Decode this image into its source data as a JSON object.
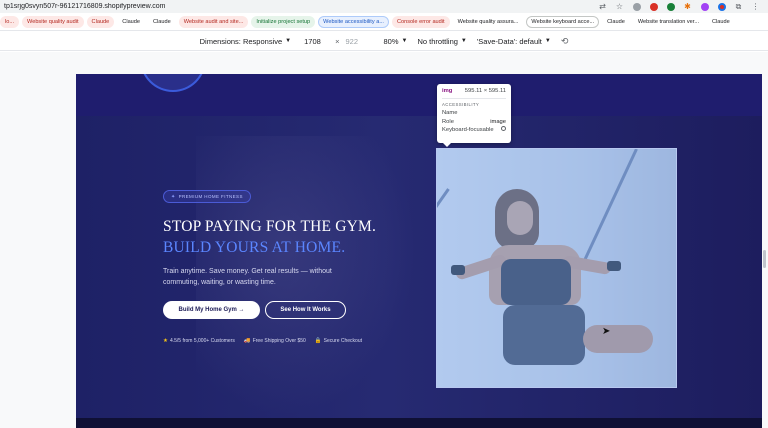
{
  "browser": {
    "url": "tp1srjg0svyn507r-96121716809.shopifypreview.com",
    "icons": [
      "translate-icon",
      "star-icon",
      "extension-icon",
      "ai-icon",
      "shield-icon",
      "asterisk-icon",
      "palette-icon",
      "chrome-icon",
      "puzzle-icon",
      "menu-icon"
    ]
  },
  "bookmarks": [
    {
      "label": "lo...",
      "style": "red"
    },
    {
      "label": "Website quality audit",
      "style": "red"
    },
    {
      "label": "Claude",
      "style": "red"
    },
    {
      "label": "Claude",
      "style": "plain"
    },
    {
      "label": "Claude",
      "style": "plain"
    },
    {
      "label": "Website audit and site...",
      "style": "red"
    },
    {
      "label": "Initialize project setup",
      "style": "green"
    },
    {
      "label": "Website accessibility a...",
      "style": "blue"
    },
    {
      "label": "Console error audit",
      "style": "red"
    },
    {
      "label": "Website quality assura...",
      "style": "plain"
    },
    {
      "label": "Website keyboard acce...",
      "style": "outline"
    },
    {
      "label": "Claude",
      "style": "plain"
    },
    {
      "label": "Website translation ver...",
      "style": "plain"
    },
    {
      "label": "Claude",
      "style": "plain"
    }
  ],
  "devtools_toolbar": {
    "dimensions_label": "Dimensions: Responsive",
    "width": "1708",
    "times": "×",
    "height_placeholder": "922",
    "zoom": "80%",
    "throttling": "No throttling",
    "save_data": "'Save-Data': default"
  },
  "hero": {
    "badge": "PREMIUM HOME FITNESS",
    "headline_main": "STOP PAYING FOR THE GYM.",
    "headline_accent": "BUILD YOURS AT HOME.",
    "subcopy": "Train anytime. Save money. Get real results — without commuting, waiting, or wasting time.",
    "primary_button": "Build My Home Gym →",
    "secondary_button": "See How It Works",
    "trust": [
      {
        "icon": "★",
        "text": "4.5/5 from 5,000+ Customers"
      },
      {
        "icon": "🚚",
        "text": "Free Shipping Over $50"
      },
      {
        "icon": "🔒",
        "text": "Secure Checkout"
      }
    ]
  },
  "inspect_tooltip": {
    "tag": "img",
    "size": "595.11 × 595.11",
    "section": "ACCESSIBILITY",
    "rows": [
      {
        "label": "Name",
        "value": ""
      },
      {
        "label": "Role",
        "value": "image"
      },
      {
        "label": "Keyboard-focusable",
        "value": ""
      }
    ]
  },
  "colors": {
    "hero_bg": "#1e2166",
    "accent": "#5b86ff",
    "photo_highlight": "#6fa0e8"
  }
}
